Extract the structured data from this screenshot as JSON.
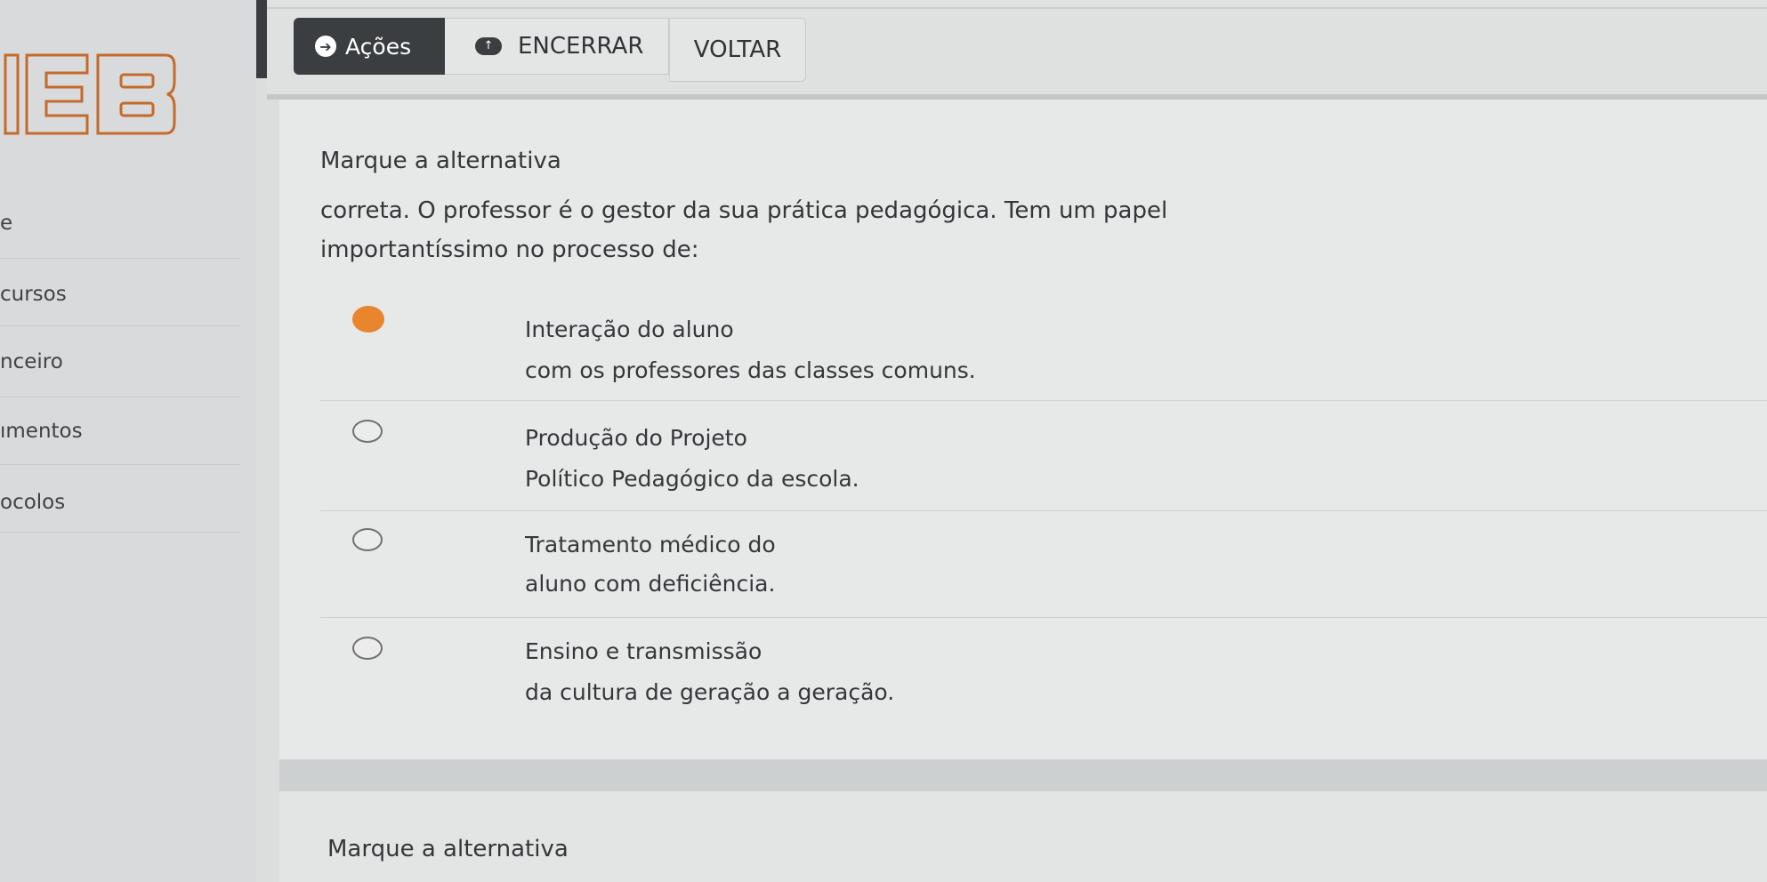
{
  "sidebar": {
    "logo_text": "IEB",
    "items": [
      {
        "label": "e"
      },
      {
        "label": "cursos"
      },
      {
        "label": "nceiro"
      },
      {
        "label": "ımentos"
      },
      {
        "label": "ocolos"
      }
    ]
  },
  "toolbar": {
    "actions_label": "Ações",
    "end_label": "ENCERRAR",
    "back_label": "VOLTAR"
  },
  "question": {
    "lines": [
      "Marque a alternativa",
      "correta. O professor é o gestor da sua prática pedagógica. Tem um papel",
      "importantíssimo no processo de:"
    ],
    "options": [
      {
        "lines": [
          "Interação do aluno",
          "com os professores das classes comuns."
        ],
        "selected": true
      },
      {
        "lines": [
          "Produção do Projeto",
          "Político Pedagógico da escola."
        ],
        "selected": false
      },
      {
        "lines": [
          "Tratamento médico do",
          "aluno com deficiência."
        ],
        "selected": false
      },
      {
        "lines": [
          "Ensino e transmissão",
          "da cultura de geração a geração."
        ],
        "selected": false
      }
    ]
  },
  "next_question": {
    "line": "Marque a alternativa"
  },
  "colors": {
    "selected_radio": "#e8852d",
    "dark_button": "#3b3e41",
    "logo_orange": "#c46a2a"
  }
}
